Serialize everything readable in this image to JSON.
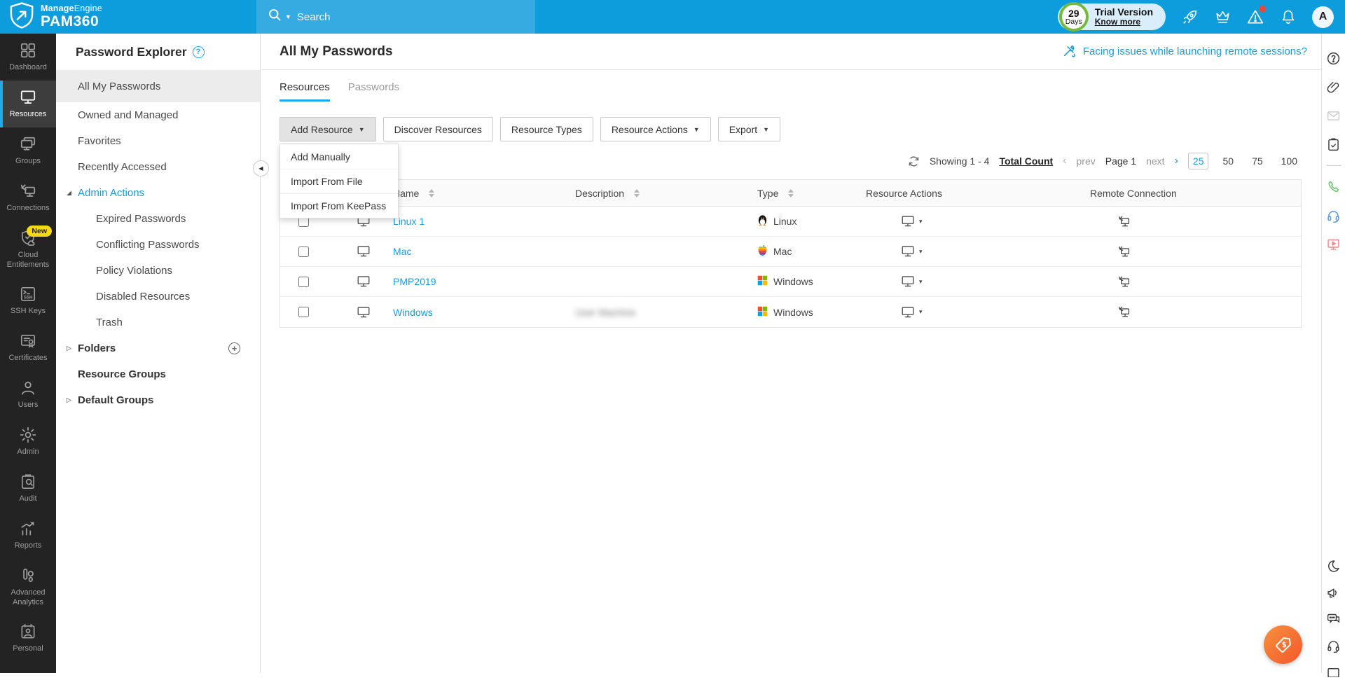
{
  "colors": {
    "topbar": "#0d9ddc",
    "search_bg": "#35abe2",
    "accent_blue": "#1d9bd8",
    "rail_bg": "#232323",
    "active_tab_underline": "#1caaf0",
    "trial_ring_green": "#76b93e",
    "new_badge_yellow": "#f5d812",
    "fab_orange": "#f2572a",
    "alert_dot_red": "#e8483f"
  },
  "header": {
    "brand_manage": "Manage",
    "brand_engine": "Engine",
    "brand_product": "PAM360",
    "search_placeholder": "Search",
    "trial": {
      "days_num": "29",
      "days_label": "Days",
      "title": "Trial Version",
      "link": "Know more"
    },
    "avatar_letter": "A"
  },
  "nav_rail": {
    "items": [
      {
        "label": "Dashboard"
      },
      {
        "label": "Resources"
      },
      {
        "label": "Groups"
      },
      {
        "label": "Connections"
      },
      {
        "label": "Cloud Entitlements",
        "badge": "New"
      },
      {
        "label": "SSH Keys"
      },
      {
        "label": "Certificates"
      },
      {
        "label": "Users"
      },
      {
        "label": "Admin"
      },
      {
        "label": "Audit"
      },
      {
        "label": "Reports"
      },
      {
        "label": "Advanced Analytics"
      },
      {
        "label": "Personal"
      }
    ],
    "active_item": "Resources"
  },
  "explorer": {
    "title": "Password Explorer",
    "items": [
      "All My Passwords",
      "Owned and Managed",
      "Favorites",
      "Recently Accessed"
    ],
    "selected_item": "All My Passwords",
    "admin_actions": {
      "label": "Admin Actions",
      "children": [
        "Expired Passwords",
        "Conflicting Passwords",
        "Policy Violations",
        "Disabled Resources",
        "Trash"
      ]
    },
    "folders_label": "Folders",
    "resource_groups_label": "Resource Groups",
    "default_groups_label": "Default Groups"
  },
  "main": {
    "title": "All My Passwords",
    "help_link": "Facing issues while launching remote sessions?",
    "tabs": [
      {
        "label": "Resources"
      },
      {
        "label": "Passwords"
      }
    ],
    "active_tab": "Resources",
    "toolbar": [
      {
        "label": "Add Resource"
      },
      {
        "label": "Discover Resources"
      },
      {
        "label": "Resource Types"
      },
      {
        "label": "Resource Actions"
      },
      {
        "label": "Export"
      }
    ],
    "dropdown": [
      "Add Manually",
      "Import From File",
      "Import From KeePass"
    ],
    "pagination": {
      "showing": "Showing 1 - 4",
      "total_count": "Total Count",
      "prev_chev": "‹",
      "prev": "prev",
      "page": "Page 1",
      "next": "next",
      "next_chev": "›",
      "sizes": [
        "25",
        "50",
        "75",
        "100"
      ],
      "active_size": "25"
    },
    "table": {
      "columns": [
        "Name",
        "Description",
        "Type",
        "Resource Actions",
        "Remote Connection"
      ],
      "rows": [
        {
          "name": "Linux 1",
          "description": "",
          "type": "Linux",
          "os": "linux",
          "desc_blurred": false
        },
        {
          "name": "Mac",
          "description": "",
          "type": "Mac",
          "os": "mac",
          "desc_blurred": false
        },
        {
          "name": "PMP2019",
          "description": "",
          "type": "Windows",
          "os": "windows",
          "desc_blurred": false
        },
        {
          "name": "Windows",
          "description": "User Machine",
          "type": "Windows",
          "os": "windows",
          "desc_blurred": true
        }
      ]
    }
  }
}
